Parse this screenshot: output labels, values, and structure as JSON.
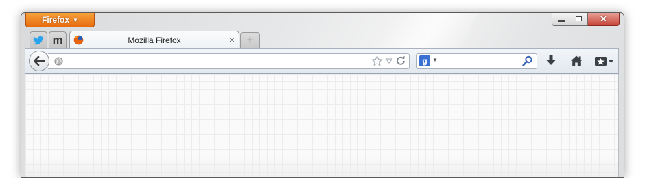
{
  "window": {
    "app_button_label": "Firefox",
    "app_button_caret": "▼",
    "controls": {
      "minimize": "minimize-icon",
      "maximize": "maximize-icon",
      "close_glyph": "✕"
    }
  },
  "tabs": {
    "app_tabs": [
      {
        "name": "twitter",
        "icon": "twitter-bird-icon",
        "color": "#2aa3ef"
      },
      {
        "name": "m",
        "glyph": "m",
        "icon": "m-letter-icon",
        "color": "#4a4a4a"
      }
    ],
    "active_tab": {
      "title": "Mozilla Firefox",
      "favicon": "firefox-logo-icon",
      "close_glyph": "×"
    },
    "new_tab_glyph": "+"
  },
  "navbar": {
    "back_icon": "back-arrow-icon",
    "url_value": "",
    "identity_icon": "globe-icon",
    "bookmark_star_icon": "star-outline-icon",
    "history_dropdown_icon": "triangle-down-icon",
    "reload_icon": "reload-icon",
    "search": {
      "engine_glyph": "g",
      "engine_icon": "google-plus-icon",
      "value": "",
      "go_icon": "magnifier-icon"
    },
    "downloads_icon": "download-arrow-icon",
    "home_icon": "home-icon",
    "bookmarks_icon": "bookmarks-star-icon"
  },
  "colors": {
    "accent_orange": "#e86c0f",
    "search_engine_blue": "#3a70d3"
  }
}
